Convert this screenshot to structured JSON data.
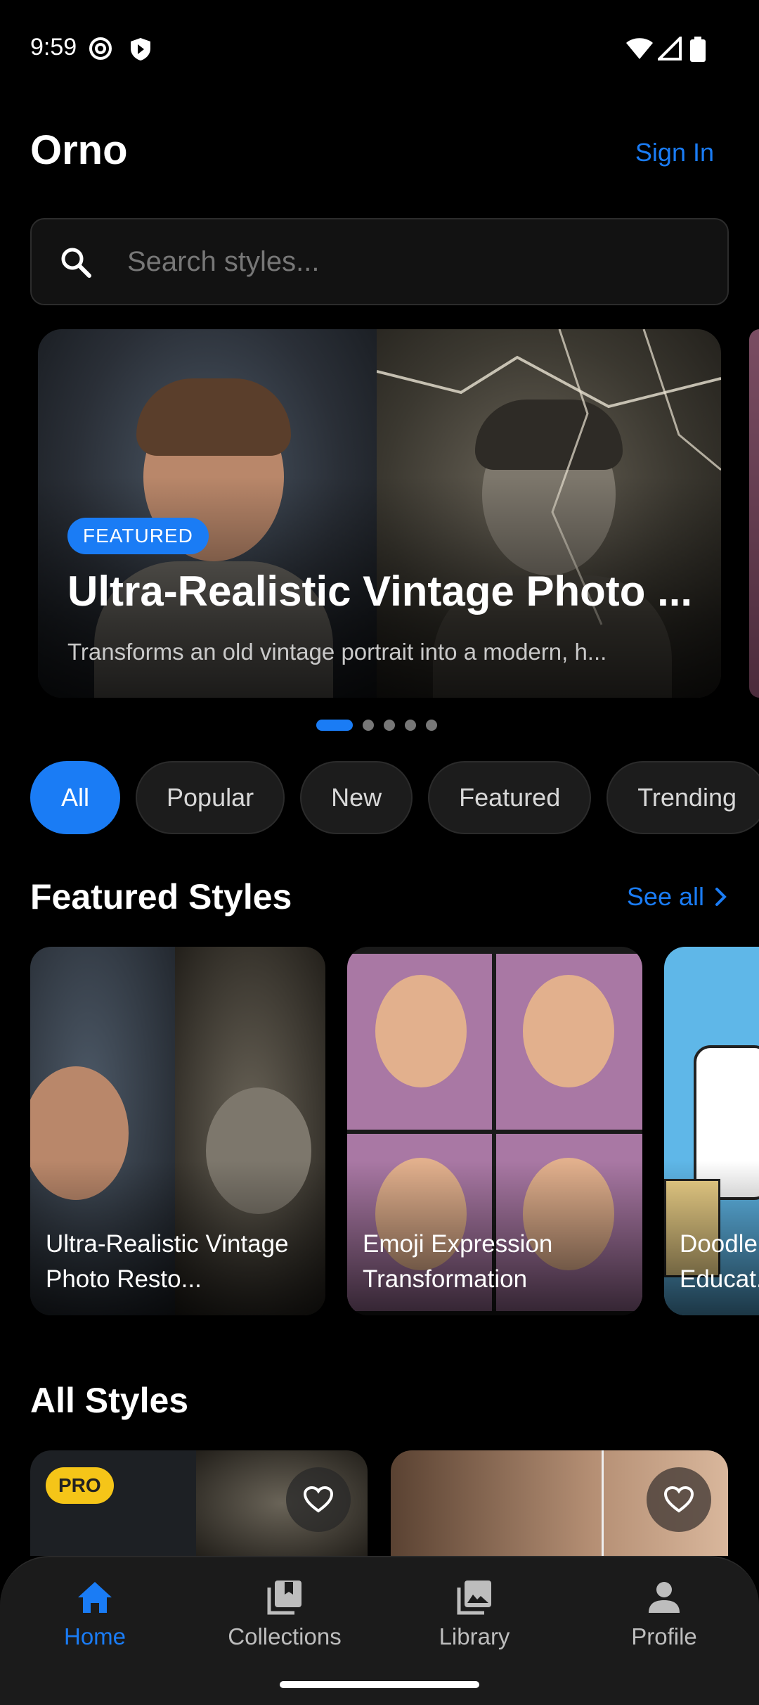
{
  "status_bar": {
    "time": "9:59",
    "icons": [
      "at-sign-icon",
      "shield-icon",
      "wifi-icon",
      "signal-icon",
      "battery-icon"
    ]
  },
  "header": {
    "title": "Orno",
    "sign_in_label": "Sign In"
  },
  "search": {
    "placeholder": "Search styles...",
    "value": ""
  },
  "hero": {
    "badge": "FEATURED",
    "title": "Ultra-Realistic Vintage Photo ...",
    "subtitle": "Transforms an old vintage portrait into a modern, h...",
    "page_count": 5,
    "active_page": 1
  },
  "filters": {
    "chips": [
      "All",
      "Popular",
      "New",
      "Featured",
      "Trending"
    ],
    "selected": "All"
  },
  "featured": {
    "title": "Featured Styles",
    "see_all_label": "See all",
    "cards": [
      {
        "label": "Ultra-Realistic Vintage Photo Resto..."
      },
      {
        "label": "Emoji Expression Transformation"
      },
      {
        "label": "Doodle Educat..."
      }
    ]
  },
  "all_styles": {
    "title": "All Styles",
    "cards": [
      {
        "badge": "PRO"
      },
      {
        "badge": ""
      }
    ]
  },
  "bottom_nav": {
    "items": [
      {
        "label": "Home",
        "icon": "home-icon"
      },
      {
        "label": "Collections",
        "icon": "collections-icon"
      },
      {
        "label": "Library",
        "icon": "library-icon"
      },
      {
        "label": "Profile",
        "icon": "profile-icon"
      }
    ],
    "active": "Home"
  },
  "colors": {
    "accent": "#1a7cf5",
    "pro_badge": "#f5c518",
    "background": "#000000"
  }
}
